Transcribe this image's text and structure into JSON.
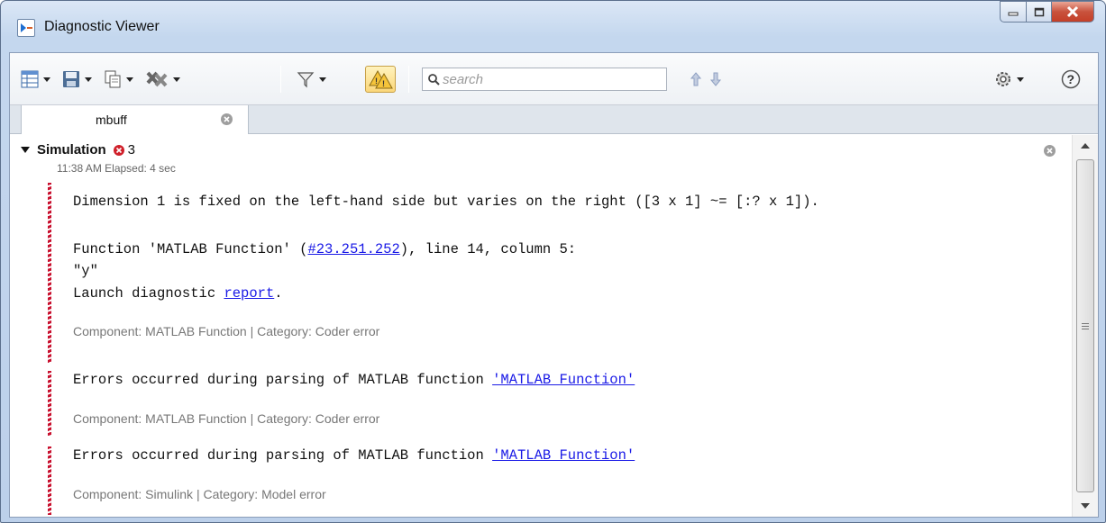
{
  "window": {
    "title": "Diagnostic Viewer"
  },
  "toolbar": {
    "search_placeholder": "search",
    "icons": [
      "grid-view-icon",
      "save-icon",
      "copy-icon",
      "clear-icon",
      "filter-icon",
      "warning-toggle-icon",
      "search-icon",
      "up-arrow-icon",
      "down-arrow-icon",
      "settings-icon",
      "help-icon"
    ]
  },
  "tab": {
    "label": "mbuff"
  },
  "stage": {
    "title": "Simulation",
    "error_count": "3",
    "time": "11:38 AM   Elapsed: 4 sec"
  },
  "diag1": {
    "line1": "Dimension 1 is fixed on the left-hand side but varies on the right ([3 x 1] ~= [:? x 1]).",
    "line2_pre": "Function 'MATLAB Function' (",
    "line2_link": "#23.251.252",
    "line2_post": "), line 14, column 5:",
    "line3": "\"y\"",
    "line4_pre": "Launch diagnostic ",
    "line4_link": "report",
    "line4_post": ".",
    "meta": "Component: MATLAB Function | Category: Coder error"
  },
  "diag2": {
    "text": "Errors occurred during parsing of MATLAB function ",
    "link": "'MATLAB Function'",
    "meta": "Component: MATLAB Function | Category: Coder error"
  },
  "diag3": {
    "text": "Errors occurred during parsing of MATLAB function ",
    "link": "'MATLAB Function'",
    "meta": "Component: Simulink | Category: Model error"
  },
  "colors": {
    "error_red": "#c8102e",
    "link_blue": "#1a1ae6"
  }
}
